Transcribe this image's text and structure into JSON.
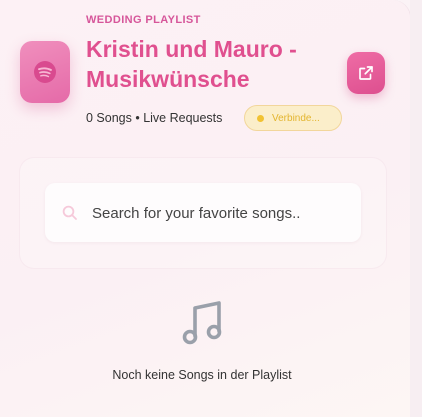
{
  "header": {
    "overline": "WEDDING PLAYLIST",
    "title": "Kristin und Mauro - Musikwünsche",
    "meta": "0 Songs • Live Requests",
    "status": {
      "text": "Verbinde...",
      "dot_color": "#f1c232"
    },
    "logo_icon": "spotify-icon",
    "action_icon": "external-link-icon"
  },
  "search": {
    "placeholder": "Search for your favorite songs..",
    "value": "",
    "icon": "search-icon"
  },
  "playlist": {
    "empty_icon": "music-note-icon",
    "empty_text": "Noch keine Songs in der Playlist"
  },
  "colors": {
    "accent": "#e0508f",
    "overline": "#d6569a",
    "status_bg": "#fbeeca",
    "status_text": "#e3b52f"
  }
}
